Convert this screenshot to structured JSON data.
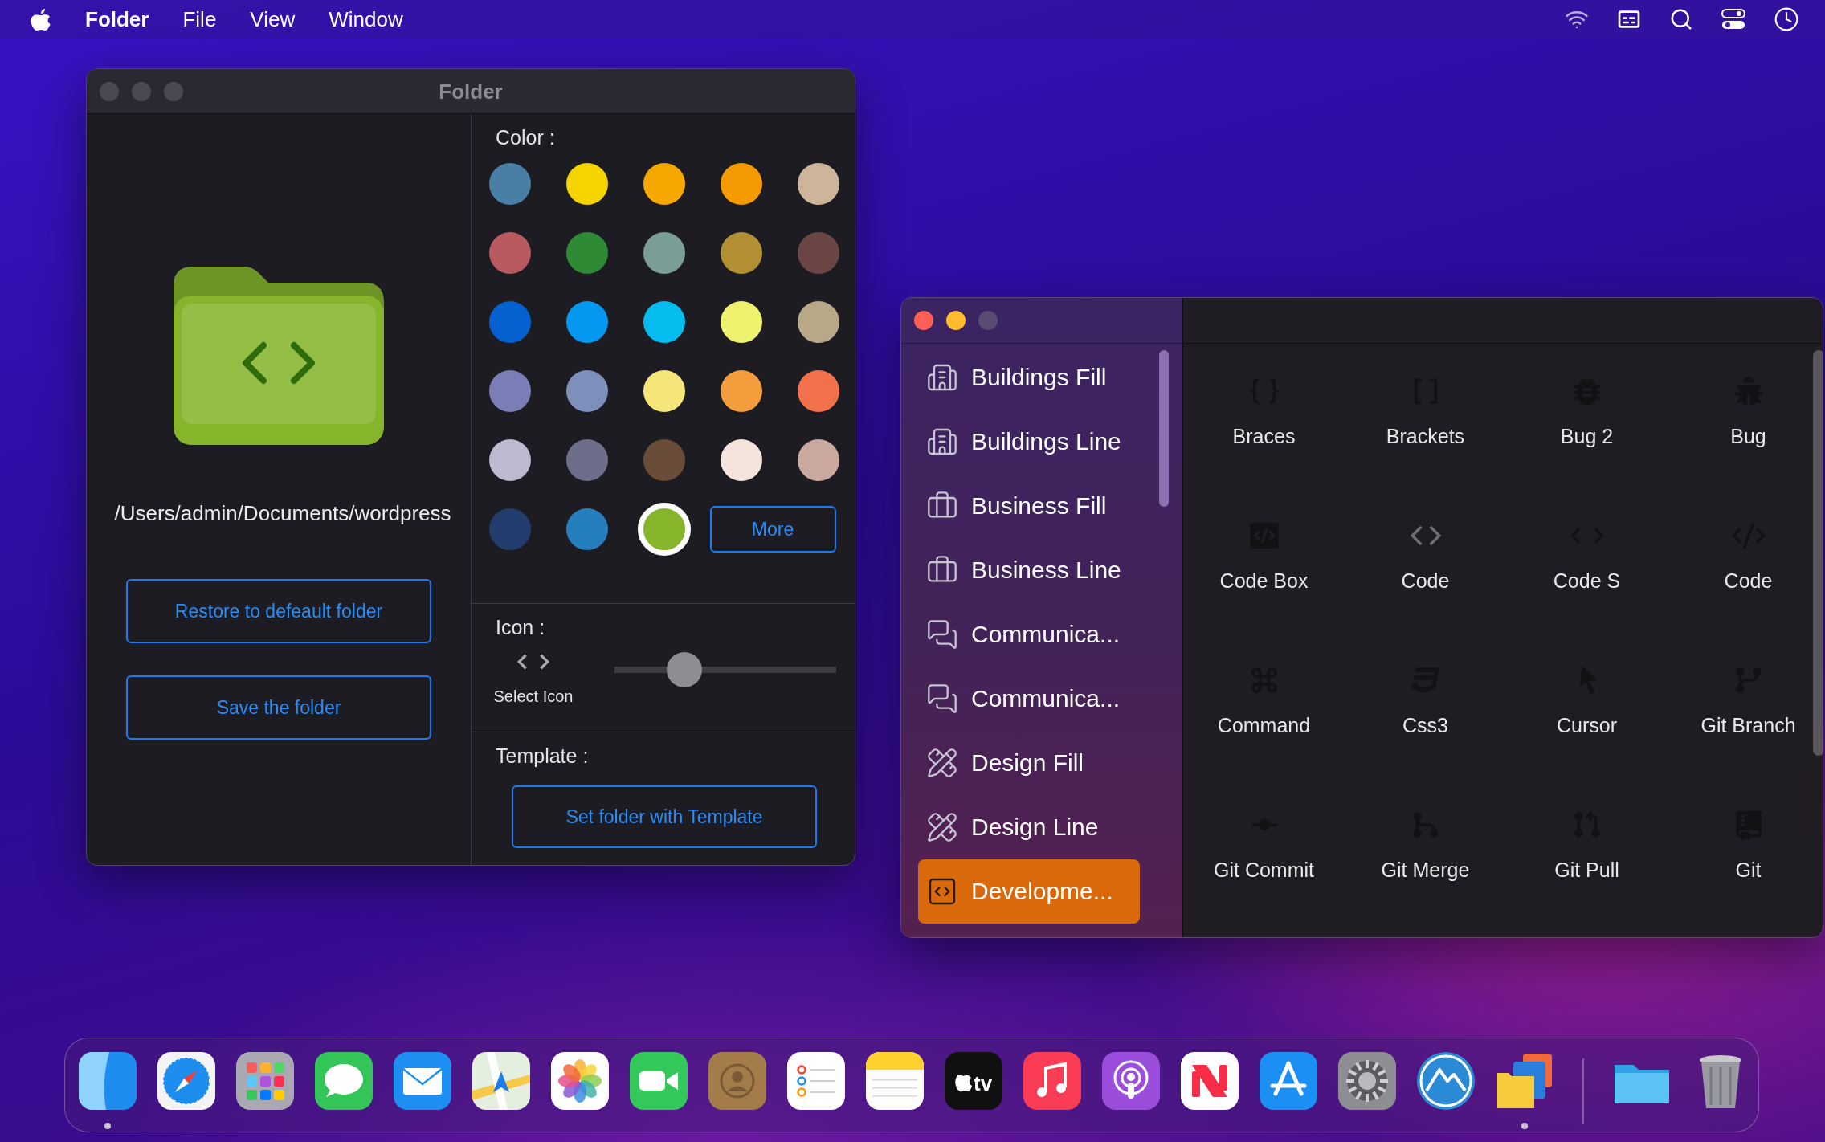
{
  "menubar": {
    "app_name": "Folder",
    "menus": [
      "File",
      "View",
      "Window"
    ]
  },
  "folder_window": {
    "title": "Folder",
    "path": "/Users/admin/Documents/wordpress",
    "buttons": [
      "Restore to defeault folder",
      "Save the folder"
    ],
    "color_section": {
      "label": "Color :",
      "more_button": "More",
      "swatches": [
        {
          "color": "#4a7fa5",
          "selected": false
        },
        {
          "color": "#f5d400",
          "selected": false
        },
        {
          "color": "#f7a800",
          "selected": false
        },
        {
          "color": "#f59a00",
          "selected": false
        },
        {
          "color": "#cdb59c",
          "selected": false
        },
        {
          "color": "#b85a5f",
          "selected": false
        },
        {
          "color": "#2f8a35",
          "selected": false
        },
        {
          "color": "#7a9e95",
          "selected": false
        },
        {
          "color": "#b38f33",
          "selected": false
        },
        {
          "color": "#6b4644",
          "selected": false
        },
        {
          "color": "#0461cf",
          "selected": false
        },
        {
          "color": "#0498f0",
          "selected": false
        },
        {
          "color": "#05bcef",
          "selected": false
        },
        {
          "color": "#eff26e",
          "selected": false
        },
        {
          "color": "#b9a888",
          "selected": false
        },
        {
          "color": "#7b7db6",
          "selected": false
        },
        {
          "color": "#7f8fbc",
          "selected": false
        },
        {
          "color": "#f5e67a",
          "selected": false
        },
        {
          "color": "#f39d3c",
          "selected": false
        },
        {
          "color": "#f2714a",
          "selected": false
        },
        {
          "color": "#bcb9d0",
          "selected": false
        },
        {
          "color": "#6d6e8a",
          "selected": false
        },
        {
          "color": "#6a4d38",
          "selected": false
        },
        {
          "color": "#f4e4dc",
          "selected": false
        },
        {
          "color": "#cba99e",
          "selected": false
        },
        {
          "color": "#233c6e",
          "selected": false
        },
        {
          "color": "#267fbd",
          "selected": false
        },
        {
          "color": "#86b52c",
          "selected": true
        }
      ]
    },
    "icon_section": {
      "label": "Icon :",
      "caption": "Select Icon",
      "slider": {
        "level": 0.28
      }
    },
    "template_section": {
      "label": "Template :",
      "button": "Set folder with Template"
    }
  },
  "icon_window": {
    "sidebar": [
      {
        "label": "Buildings Fill",
        "kind": "buildings",
        "selected": false
      },
      {
        "label": "Buildings Line",
        "kind": "buildings",
        "selected": false
      },
      {
        "label": "Business Fill",
        "kind": "business",
        "selected": false
      },
      {
        "label": "Business Line",
        "kind": "business",
        "selected": false
      },
      {
        "label": "Communica...",
        "kind": "communication",
        "selected": false
      },
      {
        "label": "Communica...",
        "kind": "communication",
        "selected": false
      },
      {
        "label": "Design Fill",
        "kind": "design",
        "selected": false
      },
      {
        "label": "Design Line",
        "kind": "design",
        "selected": false
      },
      {
        "label": "Developme...",
        "kind": "development",
        "selected": true
      }
    ],
    "icons": [
      {
        "label": "Braces",
        "kind": "braces"
      },
      {
        "label": "Brackets",
        "kind": "brackets"
      },
      {
        "label": "Bug 2",
        "kind": "bug2"
      },
      {
        "label": "Bug",
        "kind": "bug"
      },
      {
        "label": "Code Box",
        "kind": "codebox"
      },
      {
        "label": "Code",
        "kind": "code"
      },
      {
        "label": "Code S",
        "kind": "codes"
      },
      {
        "label": "Code",
        "kind": "codeslash"
      },
      {
        "label": "Command",
        "kind": "command"
      },
      {
        "label": "Css3",
        "kind": "css3"
      },
      {
        "label": "Cursor",
        "kind": "cursor"
      },
      {
        "label": "Git Branch",
        "kind": "gitbranch"
      },
      {
        "label": "Git Commit",
        "kind": "gitcommit"
      },
      {
        "label": "Git Merge",
        "kind": "gitmerge"
      },
      {
        "label": "Git Pull",
        "kind": "gitpull"
      },
      {
        "label": "Git",
        "kind": "gitpush"
      }
    ]
  },
  "dock": {
    "apps": [
      {
        "kind": "finder",
        "running": true
      },
      {
        "kind": "safari",
        "running": false
      },
      {
        "kind": "launchpad",
        "running": false
      },
      {
        "kind": "messages",
        "running": false
      },
      {
        "kind": "mail",
        "running": false
      },
      {
        "kind": "maps",
        "running": false
      },
      {
        "kind": "photos",
        "running": false
      },
      {
        "kind": "facetime",
        "running": false
      },
      {
        "kind": "contacts",
        "running": false
      },
      {
        "kind": "reminders",
        "running": false
      },
      {
        "kind": "notes",
        "running": false
      },
      {
        "kind": "tv",
        "text": "tv",
        "running": false
      },
      {
        "kind": "music",
        "running": false
      },
      {
        "kind": "podcasts",
        "running": false
      },
      {
        "kind": "news",
        "running": false
      },
      {
        "kind": "appstore",
        "running": false
      },
      {
        "kind": "settings",
        "running": false
      },
      {
        "kind": "mountains",
        "running": false
      },
      {
        "kind": "foldercolors",
        "running": true
      }
    ],
    "others": [
      {
        "kind": "folder",
        "running": false
      },
      {
        "kind": "trash",
        "running": false
      }
    ]
  }
}
